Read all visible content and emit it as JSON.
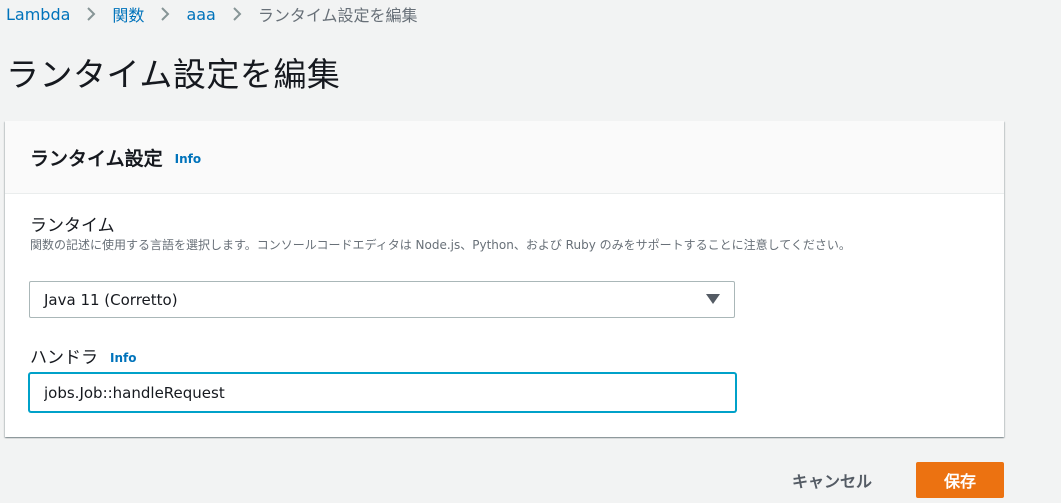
{
  "breadcrumb": {
    "items": [
      "Lambda",
      "関数",
      "aaa"
    ],
    "current": "ランタイム設定を編集"
  },
  "page": {
    "title": "ランタイム設定を編集"
  },
  "panel": {
    "title": "ランタイム設定",
    "info_label": "Info",
    "runtime": {
      "label": "ランタイム",
      "description": "関数の記述に使用する言語を選択します。コンソールコードエディタは Node.js、Python、および Ruby のみをサポートすることに注意してください。",
      "selected": "Java 11 (Corretto)"
    },
    "handler": {
      "label": "ハンドラ",
      "info_label": "Info",
      "value": "jobs.Job::handleRequest"
    }
  },
  "actions": {
    "cancel_label": "キャンセル",
    "save_label": "保存"
  },
  "colors": {
    "link": "#0073bb",
    "primary": "#ec7211",
    "focus": "#00a1c9"
  },
  "icons": {
    "separator": "chevron-right-icon",
    "dropdown": "caret-down-icon"
  }
}
